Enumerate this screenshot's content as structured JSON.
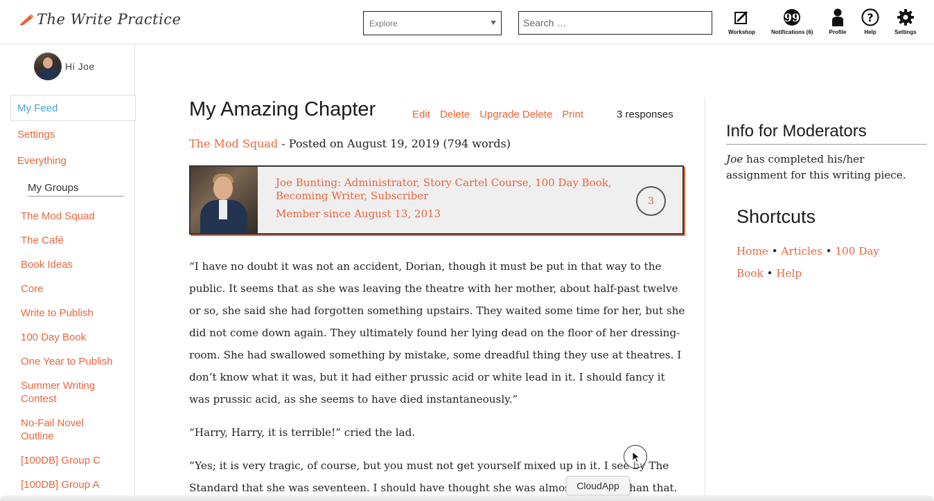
{
  "header": {
    "logo_text": "The Write Practice",
    "explore_label": "Explore",
    "search_placeholder": "Search …",
    "nav": [
      {
        "label": "Workshop",
        "icon": "edit-square-icon"
      },
      {
        "label": "Notifications (6)",
        "icon": "quote-bubble-icon"
      },
      {
        "label": "Profile",
        "icon": "person-icon"
      },
      {
        "label": "Help",
        "icon": "question-circle-icon"
      },
      {
        "label": "Settings",
        "icon": "gear-icon"
      }
    ]
  },
  "sidebar": {
    "greeting": "Hi Joe",
    "links": [
      "My Feed",
      "Settings",
      "Everything"
    ],
    "groups_heading": "My Groups",
    "groups": [
      "The Mod Squad",
      "The Café",
      "Book Ideas",
      "Core",
      "Write to Publish",
      "100 Day Book",
      "One Year to Publish",
      "Summer Writing Contest",
      "No-Fail Novel Outline",
      "[100DB] Group C",
      "[100DB] Group A"
    ]
  },
  "post": {
    "title": "My Amazing Chapter",
    "actions": [
      "Edit",
      "Delete",
      "Upgrade Delete",
      "Print"
    ],
    "responses": "3 responses",
    "group": "The Mod Squad",
    "posted": " - Posted on August 19, 2019 (794 words)",
    "author": {
      "roles": "Joe Bunting: Administrator, Story Cartel Course, 100 Day Book, Becoming Writer, Subscriber",
      "member_since": "Member since August 13, 2013",
      "count": "3"
    },
    "paragraphs": [
      "“I have no doubt it was not an accident, Dorian, though it must be put in that way to the public. It seems that as she was leaving the theatre with her mother, about half-past twelve or so, she said she had forgotten something upstairs. They waited some time for her, but she did not come down again. They ultimately found her lying dead on the floor of her dressing-room. She had swallowed something by mistake, some dreadful thing they use at theatres. I don’t know what it was, but it had either prussic acid or white lead in it. I should fancy it was prussic acid, as she seems to have died instantaneously.”",
      "“Harry, Harry, it is terrible!” cried the lad.",
      "“Yes; it is very tragic, of course, but you must not get yourself mixed up in it. I see by The Standard that she was seventeen. I should have thought she was almost younger than that."
    ]
  },
  "moderators": {
    "title": "Info for Moderators",
    "name": "Joe",
    "text": " has completed his/her assignment for this writing piece."
  },
  "shortcuts": {
    "title": "Shortcuts",
    "links": [
      "Home",
      "Articles",
      "100 Day Book",
      "Help"
    ],
    "separator": " • "
  },
  "overlay": {
    "tooltip": "CloudApp"
  },
  "colors": {
    "accent": "#e8663c",
    "active_link": "#4b9fd5"
  }
}
